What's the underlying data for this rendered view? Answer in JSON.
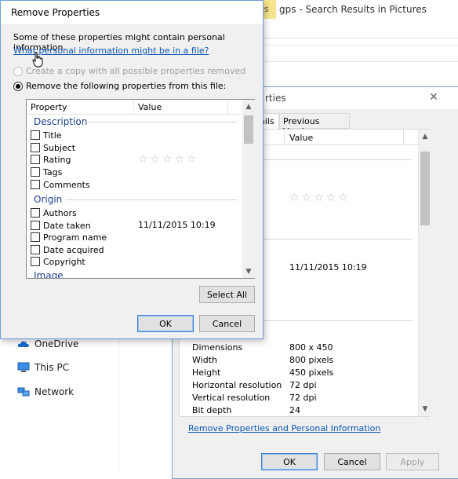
{
  "explorer": {
    "title": "gps - Search Results in Pictures",
    "tab_accent_label": "ls",
    "nav_items": [
      {
        "label": "OneDrive",
        "icon": "cloud-icon"
      },
      {
        "label": "This PC",
        "icon": "computer-icon"
      },
      {
        "label": "Network",
        "icon": "network-icon"
      }
    ]
  },
  "properties_dialog": {
    "title_fragment": "rties",
    "close_label": "✕",
    "tabs": [
      {
        "label": "ails",
        "active": true
      },
      {
        "label": "Previous Versions",
        "active": false
      }
    ],
    "column_value": "Value",
    "rating_stars": "☆☆☆☆☆",
    "date_taken": "11/11/2015 10:19",
    "image_rows": [
      {
        "name": "Dimensions",
        "value": "800 x 450"
      },
      {
        "name": "Width",
        "value": "800 pixels"
      },
      {
        "name": "Height",
        "value": "450 pixels"
      },
      {
        "name": "Horizontal resolution",
        "value": "72 dpi"
      },
      {
        "name": "Vertical resolution",
        "value": "72 dpi"
      },
      {
        "name": "Bit depth",
        "value": "24"
      }
    ],
    "remove_link": "Remove Properties and Personal Information",
    "buttons": {
      "ok": "OK",
      "cancel": "Cancel",
      "apply": "Apply"
    }
  },
  "remove_dialog": {
    "title": "Remove Properties",
    "info": "Some of these properties might contain personal information.",
    "link": "What personal information might be in a file?",
    "option_copy": "Create a copy with all possible properties removed",
    "option_remove": "Remove the following properties from this file:",
    "selected_option": "remove",
    "columns": {
      "property": "Property",
      "value": "Value"
    },
    "groups": {
      "description": {
        "title": "Description",
        "items": [
          "Title",
          "Subject",
          "Rating",
          "Tags",
          "Comments"
        ],
        "rating_stars": "☆☆☆☆☆"
      },
      "origin": {
        "title": "Origin",
        "items": [
          "Authors",
          "Date taken",
          "Program name",
          "Date acquired",
          "Copyright"
        ],
        "date_taken": "11/11/2015 10:19"
      },
      "image": {
        "title": "Image"
      }
    },
    "buttons": {
      "select_all": "Select All",
      "ok": "OK",
      "cancel": "Cancel"
    }
  },
  "scroll_up": "▲",
  "scroll_down": "▼"
}
